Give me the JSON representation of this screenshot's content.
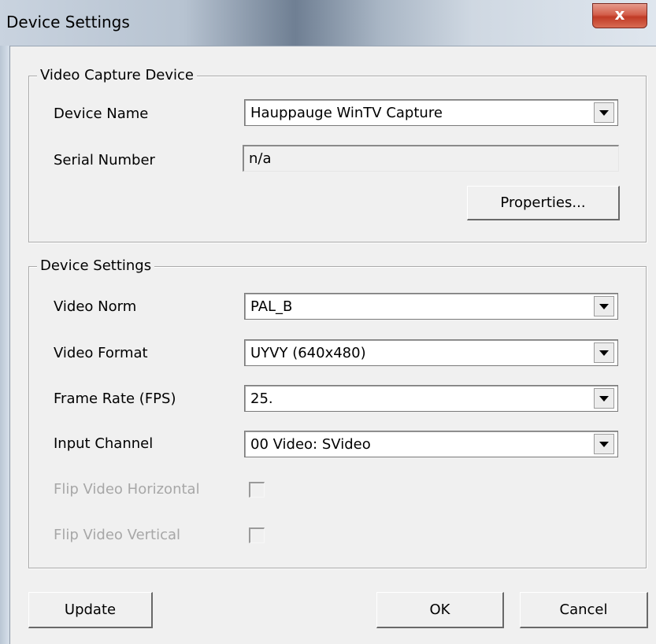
{
  "window": {
    "title": "Device Settings",
    "close_label": "x"
  },
  "capture_group": {
    "legend": "Video Capture Device",
    "device_name_label": "Device Name",
    "device_name_value": "Hauppauge WinTV Capture",
    "serial_label": "Serial Number",
    "serial_value": "n/a",
    "properties_button": "Properties..."
  },
  "settings_group": {
    "legend": "Device Settings",
    "video_norm_label": "Video Norm",
    "video_norm_value": "PAL_B",
    "video_format_label": "Video Format",
    "video_format_value": "UYVY (640x480)",
    "frame_rate_label": "Frame Rate (FPS)",
    "frame_rate_value": "25.",
    "input_channel_label": "Input Channel",
    "input_channel_value": "00 Video: SVideo",
    "flip_horizontal_label": "Flip Video Horizontal",
    "flip_horizontal_checked": false,
    "flip_vertical_label": "Flip Video Vertical",
    "flip_vertical_checked": false
  },
  "footer": {
    "update_button": "Update",
    "ok_button": "OK",
    "cancel_button": "Cancel"
  },
  "icons": {
    "dropdown": "chevron-down-icon",
    "close": "close-icon"
  },
  "colors": {
    "close_button": "#c94a34",
    "dialog_background": "#f0f0f0",
    "disabled_text": "#a7a7a7"
  }
}
